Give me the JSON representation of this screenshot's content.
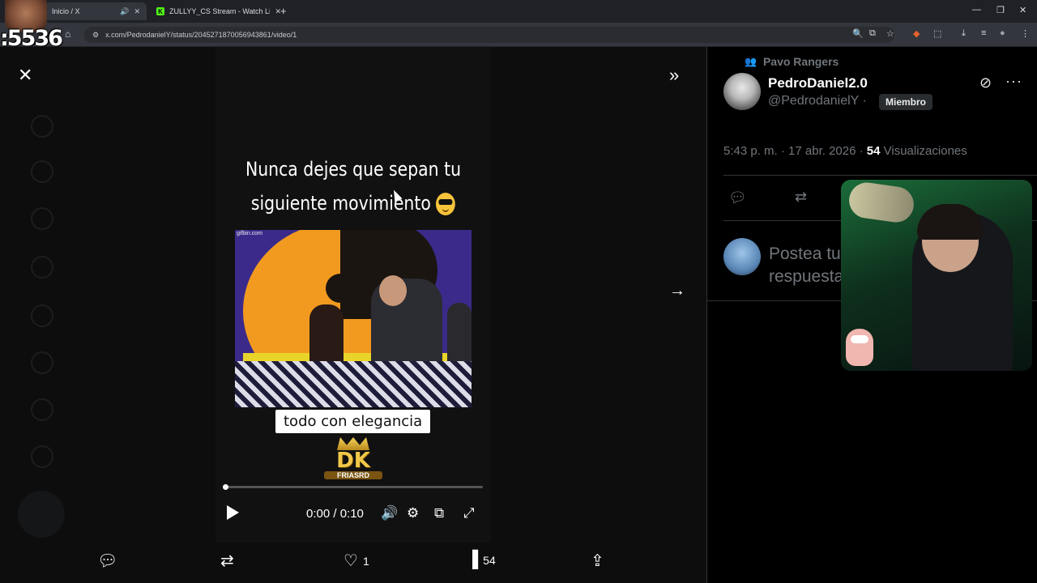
{
  "browser": {
    "tabs": [
      {
        "label": "Inicio / X",
        "icon": "speaker-icon"
      },
      {
        "label": "ZULLYY_CS Stream - Watch Live",
        "icon": "kick-icon"
      }
    ],
    "url": "x.com/PedrodanielY/status/2045271870056943861/video/1",
    "overlay_counter": ":5536"
  },
  "video": {
    "caption_line1": "Nunca dejes que sepan tu",
    "caption_line2": "siguiente movimiento",
    "frame_watermark": "gifbin.com",
    "subtitle": "todo con elegancia",
    "logo_main": "DK",
    "logo_sub": "FRIASRD",
    "time": "0:00 / 0:10",
    "progress": 0.01
  },
  "actions": {
    "likes": "1",
    "views": "54"
  },
  "post": {
    "community": "Pavo Rangers",
    "name": "PedroDaniel2.0",
    "handle": "@PedrodanielY",
    "badge": "Miembro",
    "time": "5:43 p. m. · 17 abr. 2026 ·",
    "views_num": "54",
    "views_label": "Visualizaciones",
    "reply_placeholder": "Postea tu respuesta"
  }
}
